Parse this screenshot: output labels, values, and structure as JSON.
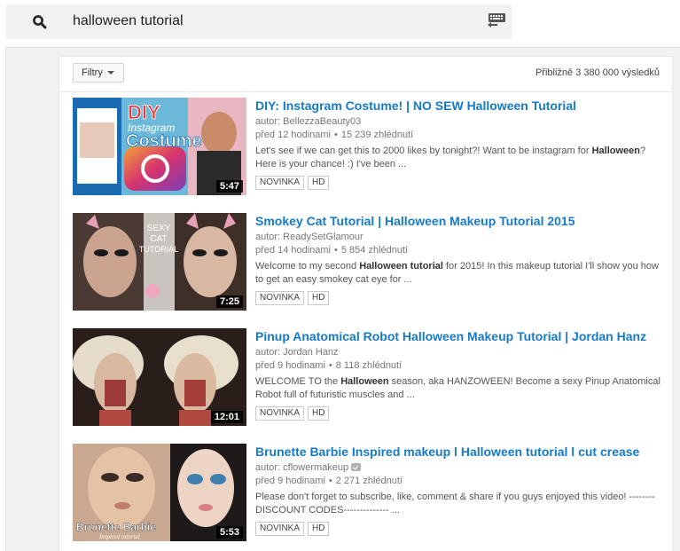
{
  "search": {
    "query": "halloween tutorial"
  },
  "toolbar": {
    "filter_label": "Filtry",
    "result_count": "Přibližně 3 380 000 výsledků"
  },
  "results": [
    {
      "title": "DIY: Instagram Costume! | NO SEW Halloween Tutorial",
      "author": "autor: BellezzaBeauty03",
      "age": "před 12 hodinami",
      "views": "15 239 zhlédnutí",
      "desc_parts": [
        "Let's see if we can get this to 2000 likes by tonight?! Want to be instagram for ",
        "Halloween",
        "? Here is your chance! :) I've been ..."
      ],
      "duration": "5:47",
      "badges": [
        "NOVINKA",
        "HD"
      ],
      "thumb_text": [
        "DIY",
        "Instagram",
        "Costume"
      ]
    },
    {
      "title": "Smokey Cat Tutorial | Halloween Makeup Tutorial 2015",
      "author": "autor: ReadySetGlamour",
      "age": "před 14 hodinami",
      "views": "5 854 zhlédnutí",
      "desc_parts": [
        "Welcome to my second ",
        "Halloween tutorial",
        " for 2015! In this makeup tutorial I'll show you how to get an easy smokey cat eye for ..."
      ],
      "duration": "7:25",
      "badges": [
        "NOVINKA",
        "HD"
      ],
      "thumb_text": [
        "SEXY",
        "CAT",
        "TUTORIAL"
      ]
    },
    {
      "title": "Pinup Anatomical Robot Halloween Makeup Tutorial | Jordan Hanz",
      "author": "autor: Jordan Hanz",
      "age": "před 9 hodinami",
      "views": "8 118 zhlédnutí",
      "desc_parts": [
        "WELCOME TO the ",
        "Halloween",
        " season, aka HANZOWEEN! Become a sexy Pinup Anatomical Robot full of futuristic muscles and ..."
      ],
      "duration": "12:01",
      "badges": [
        "NOVINKA",
        "HD"
      ]
    },
    {
      "title": "Brunette Barbie Inspired makeup l Halloween tutorial l cut crease",
      "author": "autor: cflowermakeup",
      "age": "před 9 hodinami",
      "views": "2 271 zhlédnutí",
      "desc_parts": [
        "Please don't forget to subscribe, like, comment & share if you guys enjoyed this video! -------- DISCOUNT CODES-------------- ..."
      ],
      "duration": "5:53",
      "badges": [
        "NOVINKA",
        "HD"
      ],
      "thumb_text": [
        "Brunette Barbie",
        "Inspired tutorial"
      ]
    }
  ],
  "colors": {
    "link": "#167ac6",
    "meta": "#767676",
    "page_bg": "#f1f1f1"
  }
}
